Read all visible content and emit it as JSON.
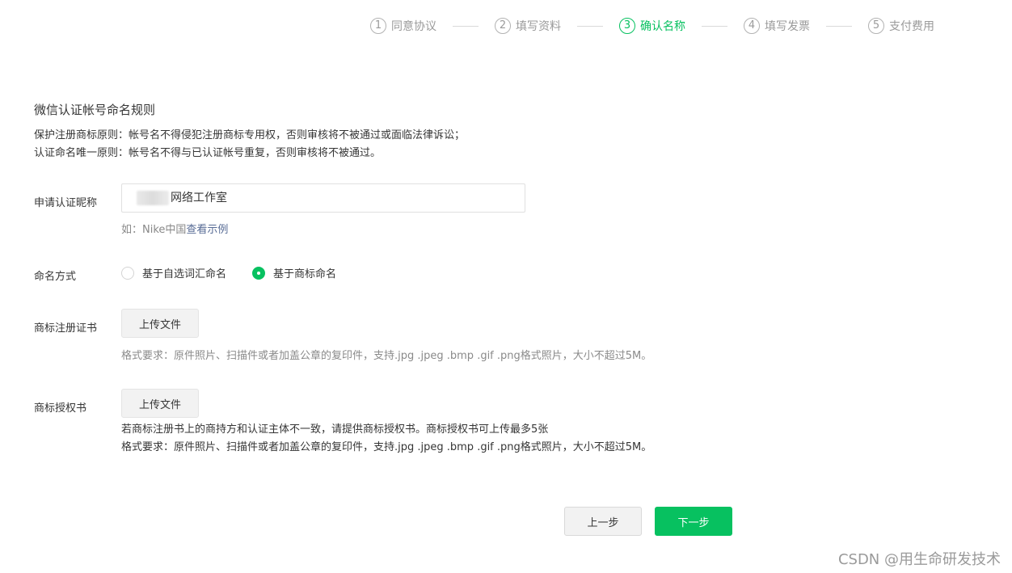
{
  "stepper": {
    "steps": [
      {
        "num": "1",
        "label": "同意协议"
      },
      {
        "num": "2",
        "label": "填写资料"
      },
      {
        "num": "3",
        "label": "确认名称"
      },
      {
        "num": "4",
        "label": "填写发票"
      },
      {
        "num": "5",
        "label": "支付费用"
      }
    ],
    "active_step": 3
  },
  "rules": {
    "title": "微信认证帐号命名规则",
    "line1": "保护注册商标原则：帐号名不得侵犯注册商标专用权，否则审核将不被通过或面临法律诉讼；",
    "line2": "认证命名唯一原则：帐号名不得与已认证帐号重复，否则审核将不被通过。"
  },
  "form": {
    "nickname": {
      "label": "申请认证昵称",
      "value": "网络工作室",
      "example_prefix": "如：Nike中国",
      "example_link": "查看示例"
    },
    "naming": {
      "label": "命名方式",
      "options": [
        "基于自选词汇命名",
        "基于商标命名"
      ],
      "selected": "基于商标命名"
    },
    "trademark_cert": {
      "label": "商标注册证书",
      "button": "上传文件",
      "hint": "格式要求：原件照片、扫描件或者加盖公章的复印件，支持.jpg .jpeg .bmp .gif .png格式照片，大小不超过5M。"
    },
    "trademark_auth": {
      "label": "商标授权书",
      "button": "上传文件",
      "hint1": "若商标注册书上的商持方和认证主体不一致，请提供商标授权书。商标授权书可上传最多5张",
      "hint2": "格式要求：原件照片、扫描件或者加盖公章的复印件，支持.jpg .jpeg .bmp .gif .png格式照片，大小不超过5M。"
    }
  },
  "actions": {
    "prev": "上一步",
    "next": "下一步"
  },
  "watermark": "CSDN @用生命研发技术",
  "colors": {
    "accent": "#07c160",
    "link": "#576b95"
  }
}
